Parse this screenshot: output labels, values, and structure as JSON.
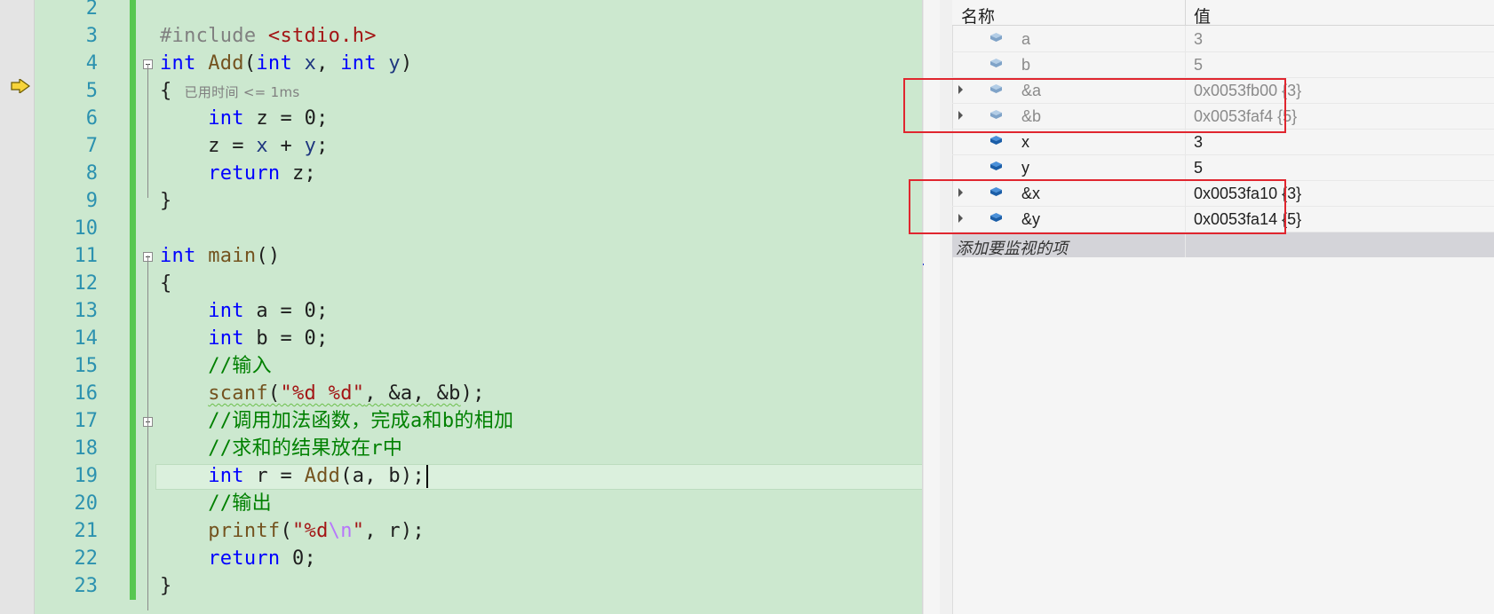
{
  "editor": {
    "lines": [
      {
        "n": "2",
        "tokens": []
      },
      {
        "n": "3",
        "tokens": [
          {
            "t": "#include ",
            "c": "pp"
          },
          {
            "t": "<stdio.h>",
            "c": "inc"
          }
        ]
      },
      {
        "n": "4",
        "fold": true,
        "tokens": [
          {
            "t": "int",
            "c": "kw"
          },
          {
            "t": " "
          },
          {
            "t": "Add",
            "c": "fn"
          },
          {
            "t": "("
          },
          {
            "t": "int",
            "c": "kw"
          },
          {
            "t": " "
          },
          {
            "t": "x",
            "c": "par"
          },
          {
            "t": ", "
          },
          {
            "t": "int",
            "c": "kw"
          },
          {
            "t": " "
          },
          {
            "t": "y",
            "c": "par"
          },
          {
            "t": ")"
          }
        ]
      },
      {
        "n": "5",
        "tokens": [
          {
            "t": "{"
          }
        ],
        "hint": "已用时间 <= 1ms"
      },
      {
        "n": "6",
        "tokens": [
          {
            "t": "    "
          },
          {
            "t": "int",
            "c": "kw"
          },
          {
            "t": " z = "
          },
          {
            "t": "0",
            "c": ""
          },
          {
            "t": ";"
          }
        ]
      },
      {
        "n": "7",
        "tokens": [
          {
            "t": "    z = "
          },
          {
            "t": "x",
            "c": "par"
          },
          {
            "t": " + "
          },
          {
            "t": "y",
            "c": "par"
          },
          {
            "t": ";"
          }
        ]
      },
      {
        "n": "8",
        "tokens": [
          {
            "t": "    "
          },
          {
            "t": "return",
            "c": "kw"
          },
          {
            "t": " z;"
          }
        ]
      },
      {
        "n": "9",
        "tokens": [
          {
            "t": "}"
          }
        ]
      },
      {
        "n": "10",
        "tokens": []
      },
      {
        "n": "11",
        "fold": true,
        "tokens": [
          {
            "t": "int",
            "c": "kw"
          },
          {
            "t": " "
          },
          {
            "t": "main",
            "c": "fn"
          },
          {
            "t": "()"
          }
        ]
      },
      {
        "n": "12",
        "tokens": [
          {
            "t": "{"
          }
        ]
      },
      {
        "n": "13",
        "tokens": [
          {
            "t": "    "
          },
          {
            "t": "int",
            "c": "kw"
          },
          {
            "t": " a = 0;"
          }
        ]
      },
      {
        "n": "14",
        "tokens": [
          {
            "t": "    "
          },
          {
            "t": "int",
            "c": "kw"
          },
          {
            "t": " b = 0;"
          }
        ]
      },
      {
        "n": "15",
        "tokens": [
          {
            "t": "    "
          },
          {
            "t": "//输入",
            "c": "cmt"
          }
        ]
      },
      {
        "n": "16",
        "tokens": [
          {
            "t": "    "
          },
          {
            "t": "scanf",
            "c": "fn squig"
          },
          {
            "t": "(",
            "c": "squig"
          },
          {
            "t": "\"%d %d\"",
            "c": "str squig"
          },
          {
            "t": ", &a, &b",
            "c": "squig"
          },
          {
            "t": ");"
          }
        ]
      },
      {
        "n": "17",
        "fold": true,
        "tokens": [
          {
            "t": "    "
          },
          {
            "t": "//调用加法函数，完成a和b的相加",
            "c": "cmt"
          }
        ]
      },
      {
        "n": "18",
        "tokens": [
          {
            "t": "    "
          },
          {
            "t": "//求和的结果放在r中",
            "c": "cmt"
          }
        ]
      },
      {
        "n": "19",
        "current": true,
        "tokens": [
          {
            "t": "    "
          },
          {
            "t": "int",
            "c": "kw"
          },
          {
            "t": " r = "
          },
          {
            "t": "Add",
            "c": "fn"
          },
          {
            "t": "(a, b);"
          }
        ]
      },
      {
        "n": "20",
        "tokens": [
          {
            "t": "    "
          },
          {
            "t": "//输出",
            "c": "cmt"
          }
        ]
      },
      {
        "n": "21",
        "tokens": [
          {
            "t": "    "
          },
          {
            "t": "printf",
            "c": "fn"
          },
          {
            "t": "("
          },
          {
            "t": "\"%d",
            "c": "str"
          },
          {
            "t": "\\n",
            "c": "esc"
          },
          {
            "t": "\"",
            "c": "str"
          },
          {
            "t": ", r);"
          }
        ]
      },
      {
        "n": "22",
        "tokens": [
          {
            "t": "    "
          },
          {
            "t": "return",
            "c": "kw"
          },
          {
            "t": " 0;"
          }
        ]
      },
      {
        "n": "23",
        "tokens": [
          {
            "t": "}"
          }
        ]
      }
    ]
  },
  "watch": {
    "header": {
      "name": "名称",
      "value": "值"
    },
    "rows": [
      {
        "name": "a",
        "value": "3",
        "state": "stale",
        "expandable": false,
        "icon": "variable-icon"
      },
      {
        "name": "b",
        "value": "5",
        "state": "stale",
        "expandable": false,
        "icon": "variable-icon"
      },
      {
        "name": "&a",
        "value": "0x0053fb00 {3}",
        "state": "stale",
        "expandable": true,
        "icon": "variable-icon"
      },
      {
        "name": "&b",
        "value": "0x0053faf4 {5}",
        "state": "stale",
        "expandable": true,
        "icon": "variable-icon"
      },
      {
        "name": "x",
        "value": "3",
        "state": "fresh",
        "expandable": false,
        "icon": "variable-icon"
      },
      {
        "name": "y",
        "value": "5",
        "state": "fresh",
        "expandable": false,
        "icon": "variable-icon"
      },
      {
        "name": "&x",
        "value": "0x0053fa10 {3}",
        "state": "fresh",
        "expandable": true,
        "icon": "variable-icon"
      },
      {
        "name": "&y",
        "value": "0x0053fa14 {5}",
        "state": "fresh",
        "expandable": true,
        "icon": "variable-icon"
      }
    ],
    "add_placeholder": "添加要监视的项"
  },
  "colors": {
    "editor_bg": "#cce8cf",
    "change_bar": "#57c750",
    "highlight_box": "#e0262f",
    "line_number": "#2b91af",
    "keyword": "#0000ff",
    "function": "#74531f",
    "string": "#a31515",
    "comment": "#008000"
  }
}
